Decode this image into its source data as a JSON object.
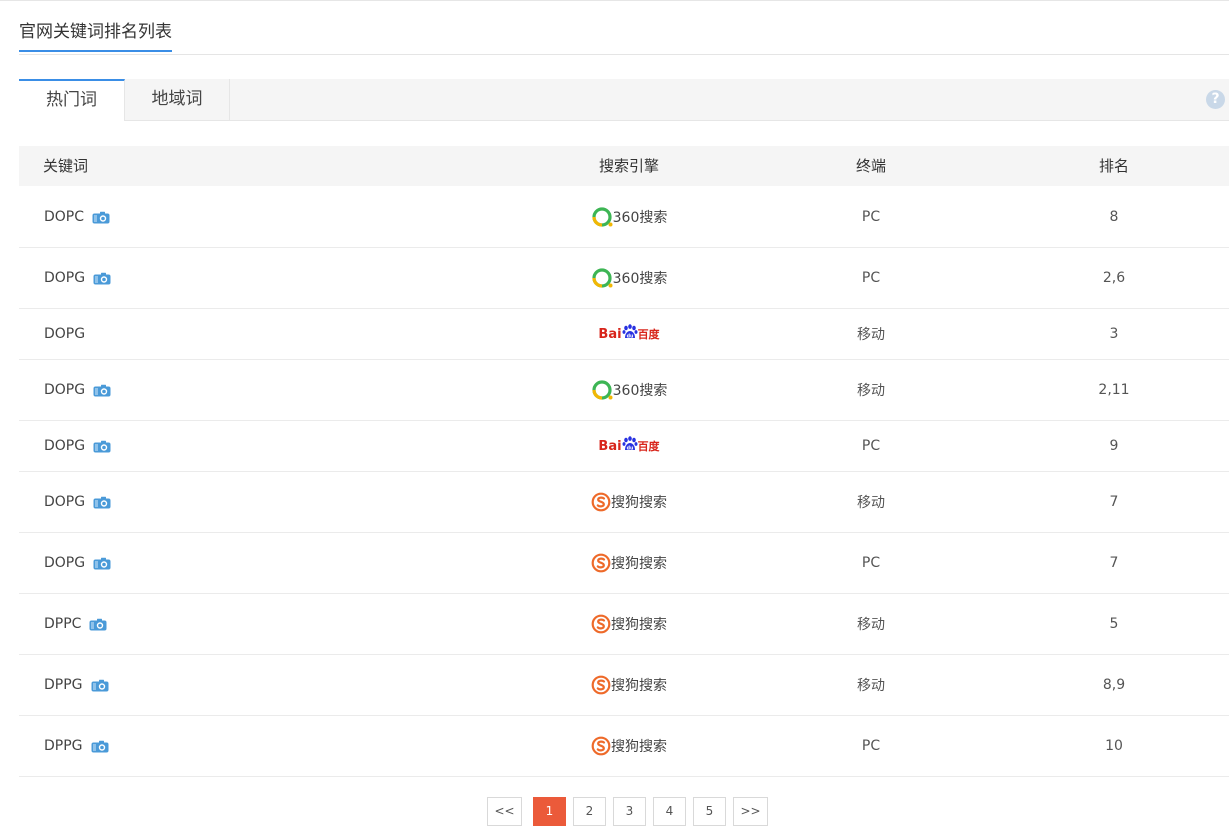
{
  "page": {
    "title": "官网关键词排名列表"
  },
  "tabs": [
    {
      "label": "热门词",
      "active": true
    },
    {
      "label": "地域词",
      "active": false
    }
  ],
  "help": {
    "symbol": "?"
  },
  "table": {
    "headers": {
      "keyword": "关键词",
      "engine": "搜索引擎",
      "terminal": "终端",
      "rank": "排名"
    },
    "rows": [
      {
        "keyword": "DOPC",
        "snapshot": true,
        "engine": "360",
        "engine_label": "360搜索",
        "terminal": "PC",
        "rank": "8"
      },
      {
        "keyword": "DOPG",
        "snapshot": true,
        "engine": "360",
        "engine_label": "360搜索",
        "terminal": "PC",
        "rank": "2,6"
      },
      {
        "keyword": "DOPG",
        "snapshot": false,
        "engine": "baidu",
        "engine_label": "Bai百度",
        "terminal": "移动",
        "rank": "3"
      },
      {
        "keyword": "DOPG",
        "snapshot": true,
        "engine": "360",
        "engine_label": "360搜索",
        "terminal": "移动",
        "rank": "2,11"
      },
      {
        "keyword": "DOPG",
        "snapshot": true,
        "engine": "baidu",
        "engine_label": "Bai百度",
        "terminal": "PC",
        "rank": "9"
      },
      {
        "keyword": "DOPG",
        "snapshot": true,
        "engine": "sogou",
        "engine_label": "搜狗搜索",
        "terminal": "移动",
        "rank": "7"
      },
      {
        "keyword": "DOPG",
        "snapshot": true,
        "engine": "sogou",
        "engine_label": "搜狗搜索",
        "terminal": "PC",
        "rank": "7"
      },
      {
        "keyword": "DPPC",
        "snapshot": true,
        "engine": "sogou",
        "engine_label": "搜狗搜索",
        "terminal": "移动",
        "rank": "5"
      },
      {
        "keyword": "DPPG",
        "snapshot": true,
        "engine": "sogou",
        "engine_label": "搜狗搜索",
        "terminal": "移动",
        "rank": "8,9"
      },
      {
        "keyword": "DPPG",
        "snapshot": true,
        "engine": "sogou",
        "engine_label": "搜狗搜索",
        "terminal": "PC",
        "rank": "10"
      }
    ]
  },
  "pagination": {
    "prev": "<<",
    "pages": [
      "1",
      "2",
      "3",
      "4",
      "5"
    ],
    "current": "1",
    "next": ">>"
  },
  "colors": {
    "accent": "#3a8ee6",
    "page_active": "#eb5a3a",
    "baidu_red": "#d8251b",
    "baidu_blue": "#2932e1",
    "green_360": "#3db554",
    "sogou_orange": "#ee6a2a"
  },
  "icons": {
    "snapshot": "camera-icon",
    "help": "help-icon"
  }
}
